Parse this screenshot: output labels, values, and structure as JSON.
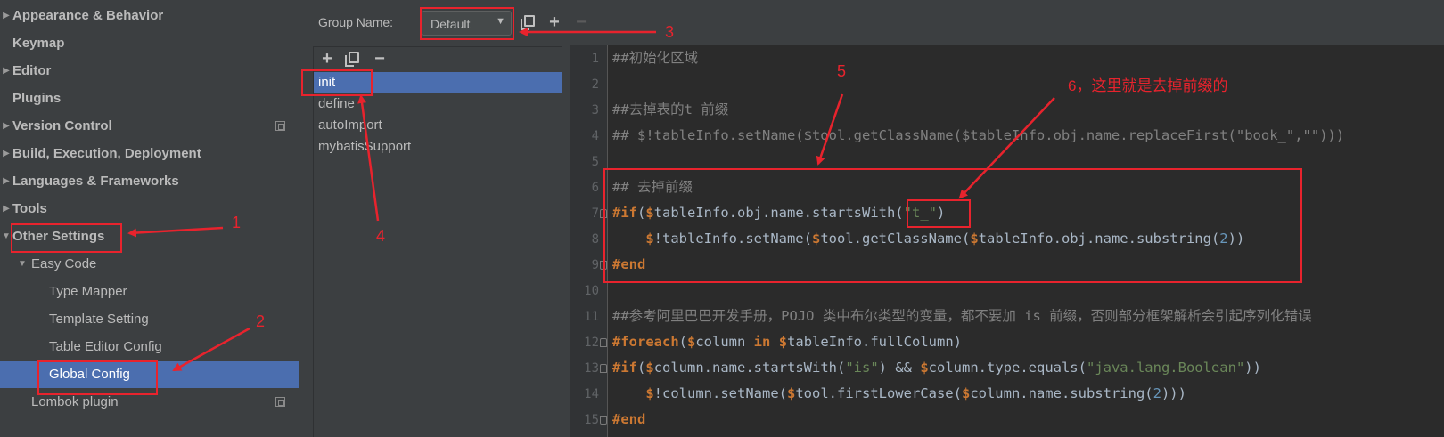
{
  "sidebar": {
    "items": [
      {
        "label": "Appearance & Behavior",
        "bold": true,
        "arrow": "▶"
      },
      {
        "label": "Keymap",
        "bold": true,
        "arrow": ""
      },
      {
        "label": "Editor",
        "bold": true,
        "arrow": "▶"
      },
      {
        "label": "Plugins",
        "bold": true,
        "arrow": ""
      },
      {
        "label": "Version Control",
        "bold": true,
        "arrow": "▶"
      },
      {
        "label": "Build, Execution, Deployment",
        "bold": true,
        "arrow": "▶"
      },
      {
        "label": "Languages & Frameworks",
        "bold": true,
        "arrow": "▶"
      },
      {
        "label": "Tools",
        "bold": true,
        "arrow": "▶"
      },
      {
        "label": "Other Settings",
        "bold": true,
        "arrow": "▼"
      },
      {
        "label": "Easy Code",
        "bold": false,
        "arrow": "▼"
      },
      {
        "label": "Type Mapper",
        "bold": false,
        "arrow": ""
      },
      {
        "label": "Template Setting",
        "bold": false,
        "arrow": ""
      },
      {
        "label": "Table Editor Config",
        "bold": false,
        "arrow": ""
      },
      {
        "label": "Global Config",
        "bold": false,
        "arrow": ""
      },
      {
        "label": "Lombok plugin",
        "bold": false,
        "arrow": ""
      }
    ],
    "selected": "Global Config"
  },
  "groupbar": {
    "label": "Group Name:",
    "value": "Default",
    "caret": "▼",
    "copy_icon": "copy-icon",
    "add": "+",
    "remove": "−"
  },
  "list": {
    "add": "+",
    "remove": "−",
    "items": [
      "init",
      "define",
      "autoImport",
      "mybatisSupport"
    ],
    "selected": "init"
  },
  "editor": {
    "line_numbers": [
      "1",
      "2",
      "3",
      "4",
      "5",
      "6",
      "7",
      "8",
      "9",
      "10",
      "11",
      "12",
      "13",
      "14",
      "15"
    ],
    "lines": [
      [
        [
          "c-comment",
          "##初始化区域"
        ]
      ],
      [],
      [
        [
          "c-comment",
          "##去掉表的t_前缀"
        ]
      ],
      [
        [
          "c-comment",
          "## $!tableInfo.setName($tool.getClassName($tableInfo.obj.name.replaceFirst(\"book_\",\"\")))"
        ]
      ],
      [],
      [
        [
          "c-comment",
          "## 去掉前缀"
        ]
      ],
      [
        [
          "c-kw",
          "#if"
        ],
        [
          "c-plain",
          "("
        ],
        [
          "c-kw",
          "$"
        ],
        [
          "c-plain",
          "tableInfo.obj.name.startsWith("
        ],
        [
          "c-str",
          "\"t_\""
        ],
        [
          "c-plain",
          ")"
        ]
      ],
      [
        [
          "c-plain",
          "    "
        ],
        [
          "c-kw",
          "$"
        ],
        [
          "c-plain",
          "!tableInfo.setName("
        ],
        [
          "c-kw",
          "$"
        ],
        [
          "c-plain",
          "tool.getClassName("
        ],
        [
          "c-kw",
          "$"
        ],
        [
          "c-plain",
          "tableInfo.obj.name.substring("
        ],
        [
          "c-num",
          "2"
        ],
        [
          "c-plain",
          "))"
        ]
      ],
      [
        [
          "c-kw",
          "#end"
        ]
      ],
      [],
      [
        [
          "c-comment",
          "##参考阿里巴巴开发手册，POJO 类中布尔类型的变量，都不要加 is 前缀，否则部分框架解析会引起序列化错误"
        ]
      ],
      [
        [
          "c-kw",
          "#foreach"
        ],
        [
          "c-plain",
          "("
        ],
        [
          "c-kw",
          "$"
        ],
        [
          "c-plain",
          "column "
        ],
        [
          "c-kw",
          "in"
        ],
        [
          "c-plain",
          " "
        ],
        [
          "c-kw",
          "$"
        ],
        [
          "c-plain",
          "tableInfo.fullColumn)"
        ]
      ],
      [
        [
          "c-kw",
          "#if"
        ],
        [
          "c-plain",
          "("
        ],
        [
          "c-kw",
          "$"
        ],
        [
          "c-plain",
          "column.name.startsWith("
        ],
        [
          "c-str",
          "\"is\""
        ],
        [
          "c-plain",
          ") && "
        ],
        [
          "c-kw",
          "$"
        ],
        [
          "c-plain",
          "column.type.equals("
        ],
        [
          "c-str",
          "\"java.lang.Boolean\""
        ],
        [
          "c-plain",
          "))"
        ]
      ],
      [
        [
          "c-plain",
          "    "
        ],
        [
          "c-kw",
          "$"
        ],
        [
          "c-plain",
          "!column.setName("
        ],
        [
          "c-kw",
          "$"
        ],
        [
          "c-plain",
          "tool.firstLowerCase("
        ],
        [
          "c-kw",
          "$"
        ],
        [
          "c-plain",
          "column.name.substring("
        ],
        [
          "c-num",
          "2"
        ],
        [
          "c-plain",
          ")))"
        ]
      ],
      [
        [
          "c-kw",
          "#end"
        ]
      ]
    ]
  },
  "annotations": {
    "n1": "1",
    "n2": "2",
    "n3": "3",
    "n4": "4",
    "n5": "5",
    "n6": "6，这里就是去掉前缀的",
    "color": "#e8232d"
  }
}
